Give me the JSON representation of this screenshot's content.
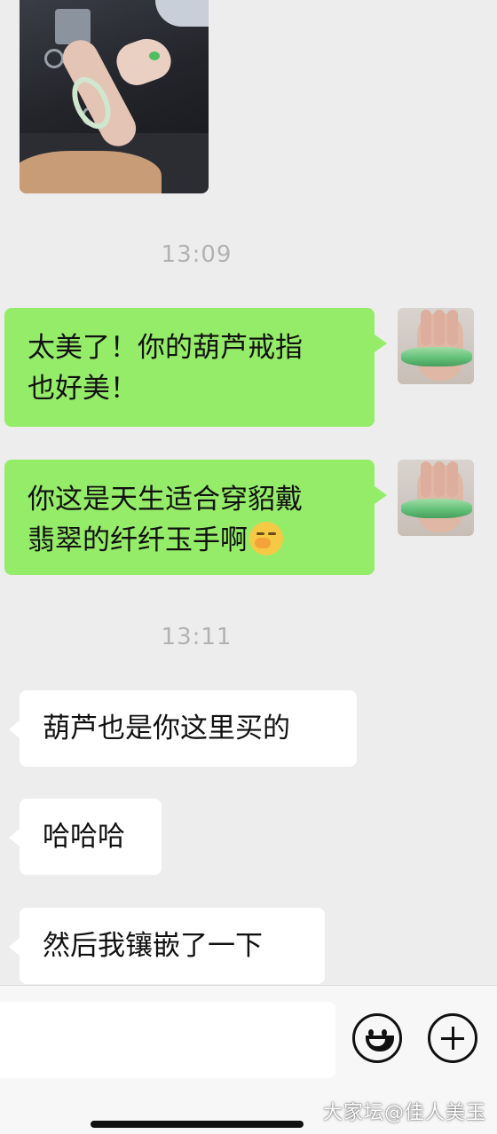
{
  "chat": {
    "timestamps": [
      "13:09",
      "13:11"
    ],
    "messages": [
      {
        "direction": "out",
        "lines": [
          "太美了！你的葫芦戒指",
          "也好美！"
        ]
      },
      {
        "direction": "out",
        "lines": [
          "你这是天生适合穿貂戴",
          "翡翠的纤纤玉手啊"
        ],
        "emoji": "shy-face-emoji"
      },
      {
        "direction": "in",
        "text": "葫芦也是你这里买的"
      },
      {
        "direction": "in",
        "text": "哈哈哈"
      },
      {
        "direction": "in",
        "text": "然后我镶嵌了一下"
      }
    ]
  },
  "input_bar": {
    "value": "",
    "placeholder": ""
  },
  "watermark": "大家坛@佳人美玉",
  "colors": {
    "outgoing_bubble": "#95ec69",
    "incoming_bubble": "#ffffff",
    "background": "#ededed",
    "timestamp": "#b2b2b2"
  }
}
